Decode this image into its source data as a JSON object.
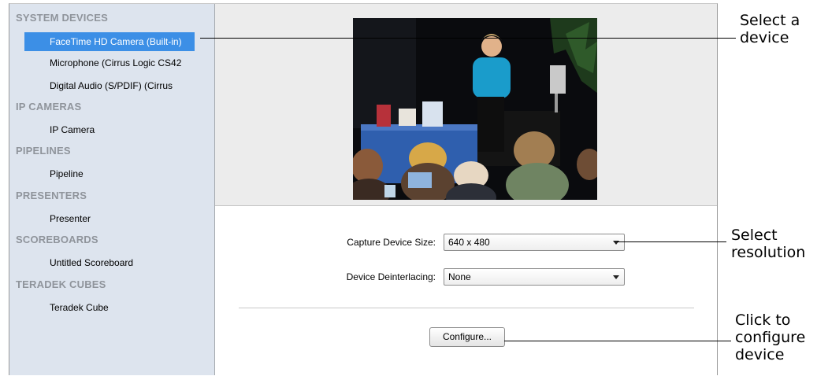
{
  "sidebar": {
    "groups": [
      {
        "title": "SYSTEM DEVICES",
        "items": [
          {
            "label": "FaceTime HD Camera (Built-in)",
            "selected": true
          },
          {
            "label": "Microphone (Cirrus Logic CS42"
          },
          {
            "label": "Digital Audio (S/PDIF) (Cirrus"
          }
        ]
      },
      {
        "title": "IP CAMERAS",
        "items": [
          {
            "label": "IP Camera"
          }
        ]
      },
      {
        "title": "PIPELINES",
        "items": [
          {
            "label": "Pipeline"
          }
        ]
      },
      {
        "title": "PRESENTERS",
        "items": [
          {
            "label": "Presenter"
          }
        ]
      },
      {
        "title": "SCOREBOARDS",
        "items": [
          {
            "label": "Untitled Scoreboard"
          }
        ]
      },
      {
        "title": "TERADEK CUBES",
        "items": [
          {
            "label": "Teradek Cube"
          }
        ]
      }
    ]
  },
  "settings": {
    "capture_size": {
      "label": "Capture Device Size:",
      "value": "640 x 480"
    },
    "deinterlacing": {
      "label": "Device Deinterlacing:",
      "value": "None"
    },
    "configure_label": "Configure..."
  },
  "callouts": {
    "select_device": [
      "Select a",
      "device"
    ],
    "select_resolution": [
      "Select",
      "resolution"
    ],
    "configure_device": [
      "Click to",
      "configure",
      "device"
    ]
  },
  "colors": {
    "selection": "#3c8fe6",
    "sidebar_bg": "#dde4ee",
    "group_header": "#8f949b"
  }
}
